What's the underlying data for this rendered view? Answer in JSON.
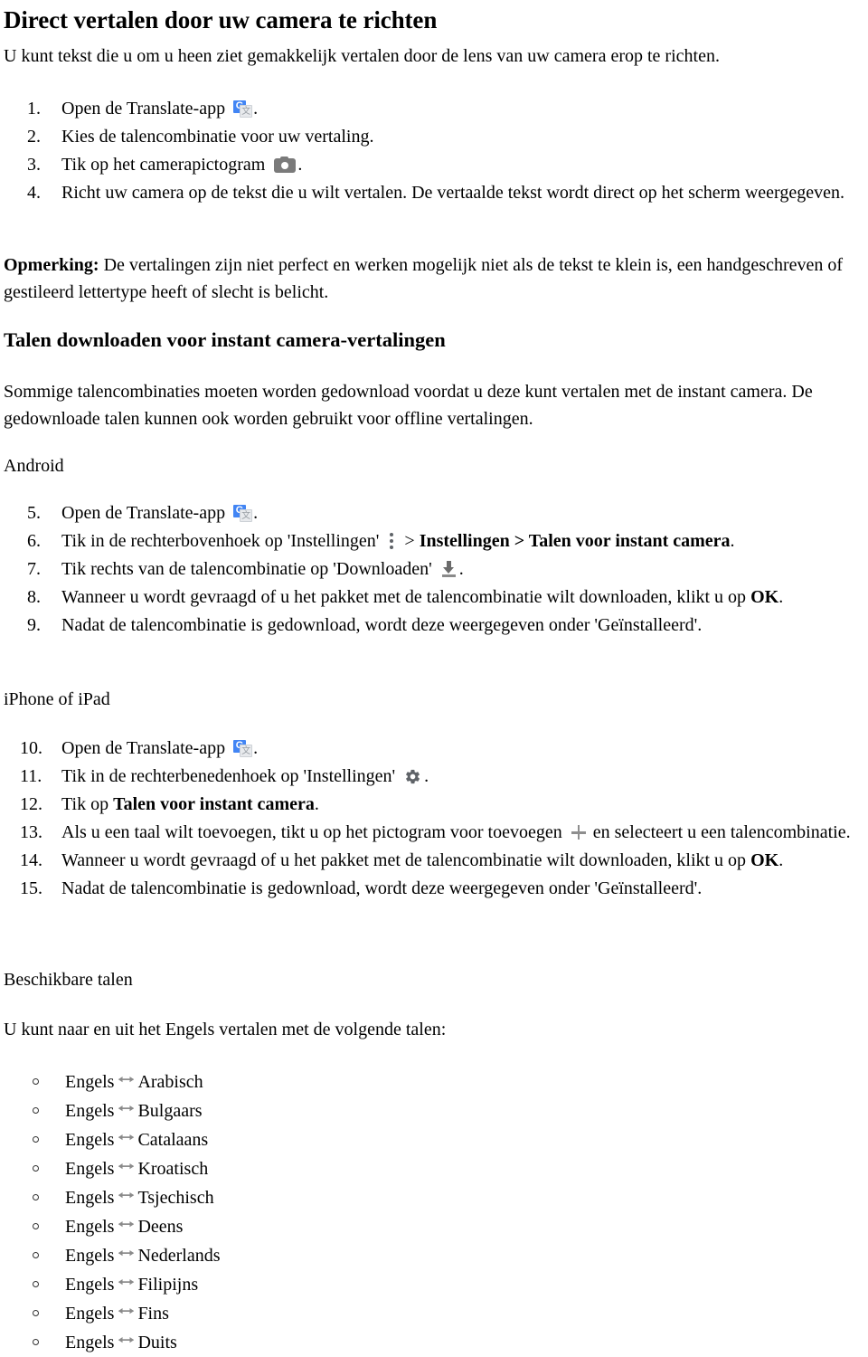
{
  "document": {
    "title": "Direct vertalen door uw camera te richten",
    "intro": "U kunt tekst die u om u heen ziet gemakkelijk vertalen door de lens van uw camera erop te richten.",
    "note_label": "Opmerking:",
    "note_text": " De vertalingen zijn niet perfect en werken mogelijk niet als de tekst te klein is, een handgeschreven of gestileerd lettertype heeft of slecht is belicht.",
    "section_title": "Talen downloaden voor instant camera-vertalingen",
    "section_intro": "Sommige talencombinaties moeten worden gedownload voordat u deze kunt vertalen met de instant camera. De gedownloade talen kunnen ook worden gebruikt voor offline vertalingen.",
    "android_label": "Android",
    "iphone_label": "iPhone of iPad",
    "available_title": "Beschikbare talen",
    "available_intro": "U kunt naar en uit het Engels vertalen met de volgende talen:"
  },
  "steps_top": [
    {
      "num": "1.",
      "text_before": "Open de Translate-app ",
      "icon": "google-translate-icon",
      "text_after": "."
    },
    {
      "num": "2.",
      "text_before": "Kies de talencombinatie voor uw vertaling.",
      "icon": "",
      "text_after": ""
    },
    {
      "num": "3.",
      "text_before": "Tik op het camerapictogram ",
      "icon": "camera-icon",
      "text_after": "."
    },
    {
      "num": "4.",
      "text_before": "Richt uw camera op de tekst die u wilt vertalen. De vertaalde tekst wordt direct op het scherm weergegeven.",
      "icon": "",
      "text_after": ""
    }
  ],
  "steps_android": [
    {
      "num": "5.",
      "parts": [
        {
          "t": "Open de Translate-app "
        },
        {
          "icon": "google-translate-icon"
        },
        {
          "t": "."
        }
      ]
    },
    {
      "num": "6.",
      "parts": [
        {
          "t": "Tik in de rechterbovenhoek op 'Instellingen' "
        },
        {
          "icon": "three-dots-icon"
        },
        {
          "t": " > "
        },
        {
          "t": "Instellingen > Talen voor instant camera",
          "bold": true
        },
        {
          "t": "."
        }
      ]
    },
    {
      "num": "7.",
      "parts": [
        {
          "t": "Tik rechts van de talencombinatie op 'Downloaden' "
        },
        {
          "icon": "download-icon"
        },
        {
          "t": "."
        }
      ]
    },
    {
      "num": "8.",
      "parts": [
        {
          "t": "Wanneer u wordt gevraagd of u het pakket met de talencombinatie wilt downloaden, klikt u op "
        },
        {
          "t": "OK",
          "bold": true
        },
        {
          "t": "."
        }
      ]
    },
    {
      "num": "9.",
      "parts": [
        {
          "t": "Nadat de talencombinatie is gedownload, wordt deze weergegeven onder 'Geïnstalleerd'."
        }
      ]
    }
  ],
  "steps_ios": [
    {
      "num": "10.",
      "parts": [
        {
          "t": "Open de Translate-app "
        },
        {
          "icon": "google-translate-icon"
        },
        {
          "t": "."
        }
      ]
    },
    {
      "num": "11.",
      "parts": [
        {
          "t": "Tik in de rechterbenedenhoek op 'Instellingen' "
        },
        {
          "icon": "gear-icon"
        },
        {
          "t": "."
        }
      ]
    },
    {
      "num": "12.",
      "parts": [
        {
          "t": "Tik op "
        },
        {
          "t": "Talen voor instant camera",
          "bold": true
        },
        {
          "t": "."
        }
      ]
    },
    {
      "num": "13.",
      "parts": [
        {
          "t": "Als u een taal wilt toevoegen, tikt u op het pictogram voor toevoegen "
        },
        {
          "icon": "plus-icon"
        },
        {
          "t": " en selecteert u een talencombinatie."
        }
      ]
    },
    {
      "num": "14.",
      "parts": [
        {
          "t": "Wanneer u wordt gevraagd of u het pakket met de talencombinatie wilt downloaden, klikt u op "
        },
        {
          "t": "OK",
          "bold": true
        },
        {
          "t": "."
        }
      ]
    },
    {
      "num": "15.",
      "parts": [
        {
          "t": "Nadat de talencombinatie is gedownload, wordt deze weergegeven onder 'Geïnstalleerd'."
        }
      ]
    }
  ],
  "languages": {
    "source": "Engels",
    "swap_icon": "swap-arrows-icon",
    "targets": [
      "Arabisch",
      "Bulgaars",
      "Catalaans",
      "Kroatisch",
      "Tsjechisch",
      "Deens",
      "Nederlands",
      "Filipijns",
      "Fins",
      "Duits"
    ]
  },
  "icon_glyphs": {
    "google_translate_g": "G",
    "google_translate_char": "文"
  },
  "colors": {
    "translate_blue": "#4285F4",
    "icon_grey": "#7a7a7a",
    "text": "#000000"
  }
}
